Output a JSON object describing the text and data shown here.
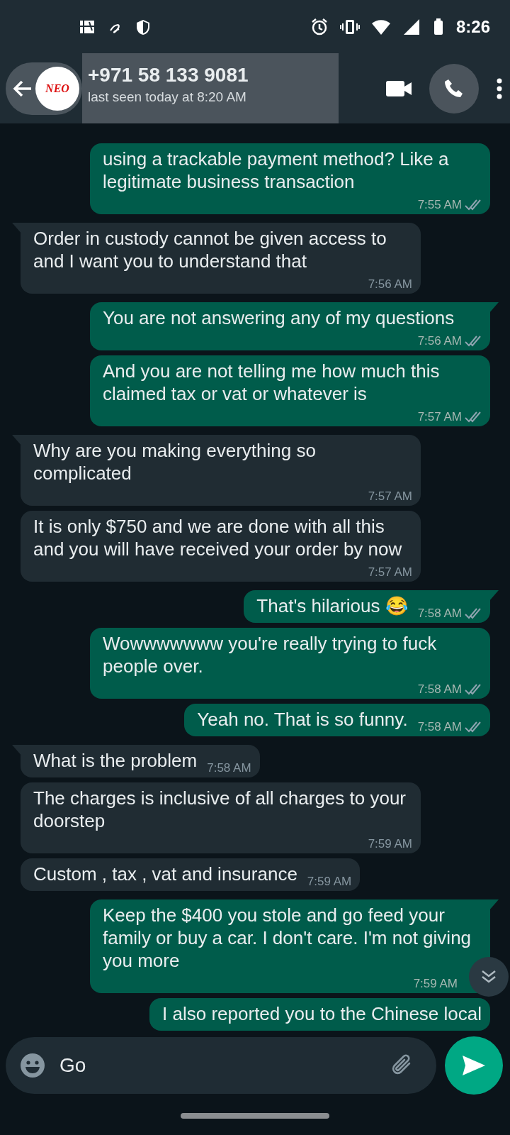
{
  "status_bar": {
    "time": "8:26"
  },
  "header": {
    "avatar_text": "NEO",
    "title": "+971 58 133 9081",
    "subtitle": "last seen today at 8:20 AM",
    "title_selected": true
  },
  "messages": [
    {
      "kind": "out",
      "text": "using a trackable payment method? Like a legitimate business transaction",
      "time": "7:55 AM",
      "tail": false,
      "ticks": true
    },
    {
      "kind": "in",
      "text": "Order in custody cannot be given access to and I want you to understand that",
      "time": "7:56 AM",
      "tail": true
    },
    {
      "kind": "out",
      "text": "You are not answering any of my questions",
      "time": "7:56 AM",
      "tail": true,
      "ticks": true
    },
    {
      "kind": "out",
      "text": "And you are not telling me how much this claimed tax or vat or whatever is",
      "time": "7:57 AM",
      "tail": false,
      "ticks": true
    },
    {
      "kind": "in",
      "text": "Why are you making everything so complicated",
      "time": "7:57 AM",
      "tail": true
    },
    {
      "kind": "in",
      "text": "It is only $750 and we are done with all this and you will have received your order by now",
      "time": "7:57 AM",
      "tail": false
    },
    {
      "kind": "out",
      "text": "That's hilarious 😂",
      "time": "7:58 AM",
      "tail": true,
      "ticks": true
    },
    {
      "kind": "out",
      "text": "Wowwwwwww you're really trying to fuck people over.",
      "time": "7:58 AM",
      "tail": false,
      "ticks": true
    },
    {
      "kind": "out",
      "text": "Yeah no. That is so funny.",
      "time": "7:58 AM",
      "tail": false,
      "ticks": true
    },
    {
      "kind": "in",
      "text": "What is the problem",
      "time": "7:58 AM",
      "tail": true
    },
    {
      "kind": "in",
      "text": "The charges is inclusive of all charges to your doorstep",
      "time": "7:59 AM",
      "tail": false
    },
    {
      "kind": "in",
      "text": "Custom , tax , vat and insurance",
      "time": "7:59 AM",
      "tail": false
    },
    {
      "kind": "out",
      "text": "Keep the $400 you stole and go feed your family or buy a car. I don't care. I'm not giving you more",
      "time": "7:59 AM",
      "tail": true,
      "ticks": false
    },
    {
      "kind": "out",
      "text": "I also reported you to the Chinese local",
      "tail": false
    }
  ],
  "composer": {
    "value": "Go"
  }
}
